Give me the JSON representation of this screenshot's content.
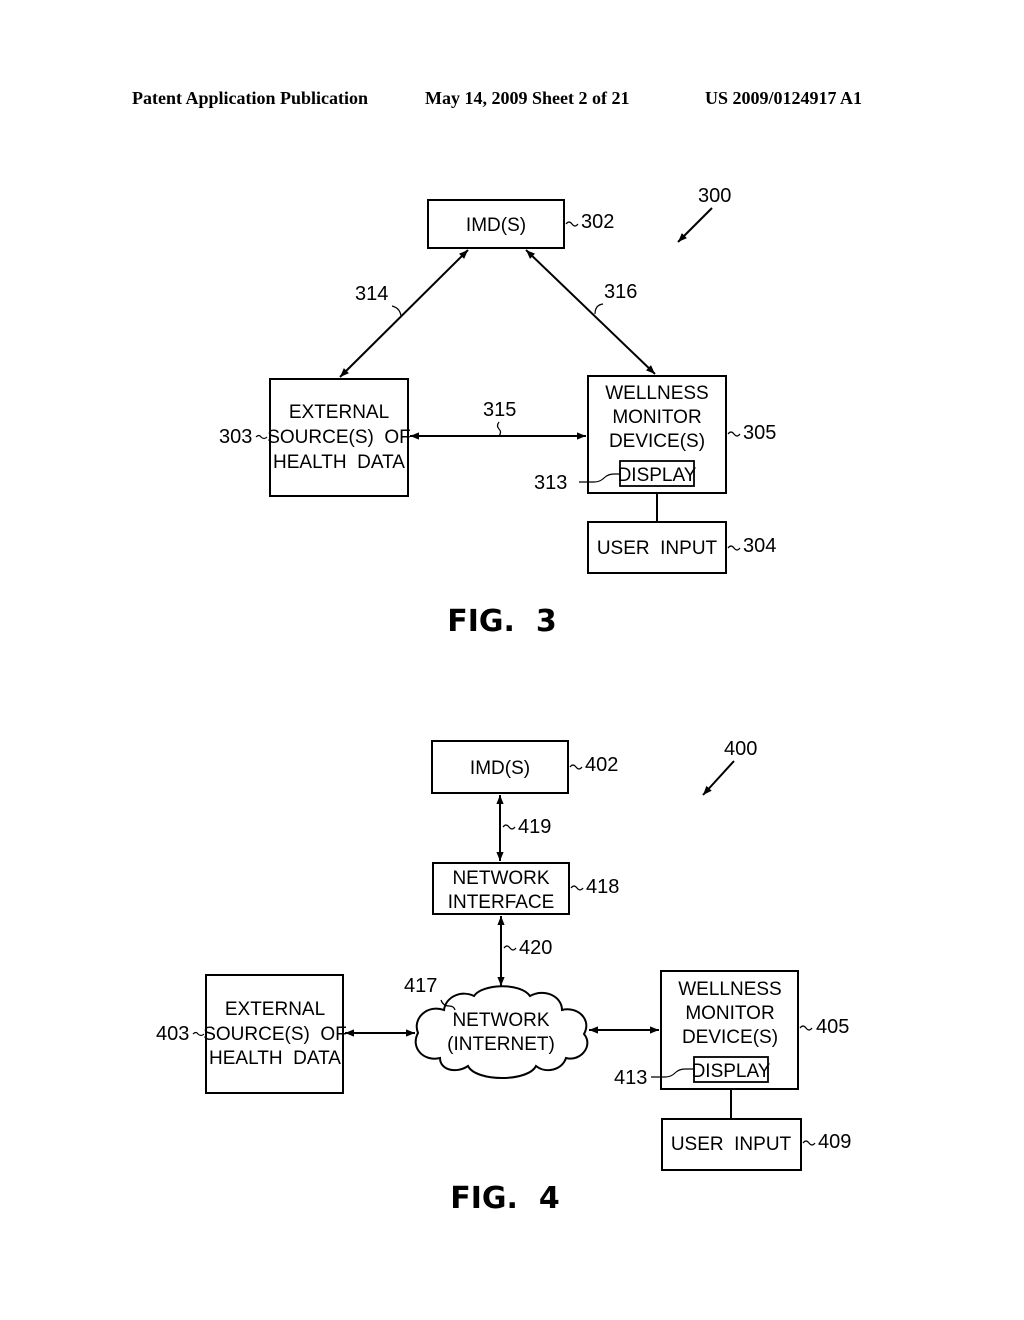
{
  "header": {
    "publication": "Patent Application Publication",
    "date_sheet": "May 14, 2009  Sheet 2 of 21",
    "number": "US 2009/0124917 A1"
  },
  "fig3": {
    "caption": "FIG.  3",
    "ref_system": "300",
    "imd": {
      "label": "IMD(S)",
      "ref": "302"
    },
    "external": {
      "lines": [
        "EXTERNAL",
        "SOURCE(S)  OF",
        "HEALTH  DATA"
      ],
      "ref": "303"
    },
    "wellness": {
      "lines": [
        "WELLNESS",
        "MONITOR",
        "DEVICE(S)"
      ],
      "ref": "305"
    },
    "display": {
      "label": "DISPLAY",
      "ref": "313"
    },
    "user_input": {
      "label": "USER  INPUT",
      "ref": "304"
    },
    "links": {
      "imd_external": "314",
      "external_wellness": "315",
      "imd_wellness": "316"
    }
  },
  "fig4": {
    "caption": "FIG.  4",
    "ref_system": "400",
    "imd": {
      "label": "IMD(S)",
      "ref": "402"
    },
    "network_interface": {
      "lines": [
        "NETWORK",
        "INTERFACE"
      ],
      "ref": "418"
    },
    "network": {
      "lines": [
        "NETWORK",
        "(INTERNET)"
      ],
      "ref": "417"
    },
    "external": {
      "lines": [
        "EXTERNAL",
        "SOURCE(S)  OF",
        "HEALTH  DATA"
      ],
      "ref": "403"
    },
    "wellness": {
      "lines": [
        "WELLNESS",
        "MONITOR",
        "DEVICE(S)"
      ],
      "ref": "405"
    },
    "display": {
      "label": "DISPLAY",
      "ref": "413"
    },
    "user_input": {
      "label": "USER  INPUT",
      "ref": "409"
    },
    "links": {
      "imd_interface": "419",
      "interface_network": "420"
    }
  }
}
